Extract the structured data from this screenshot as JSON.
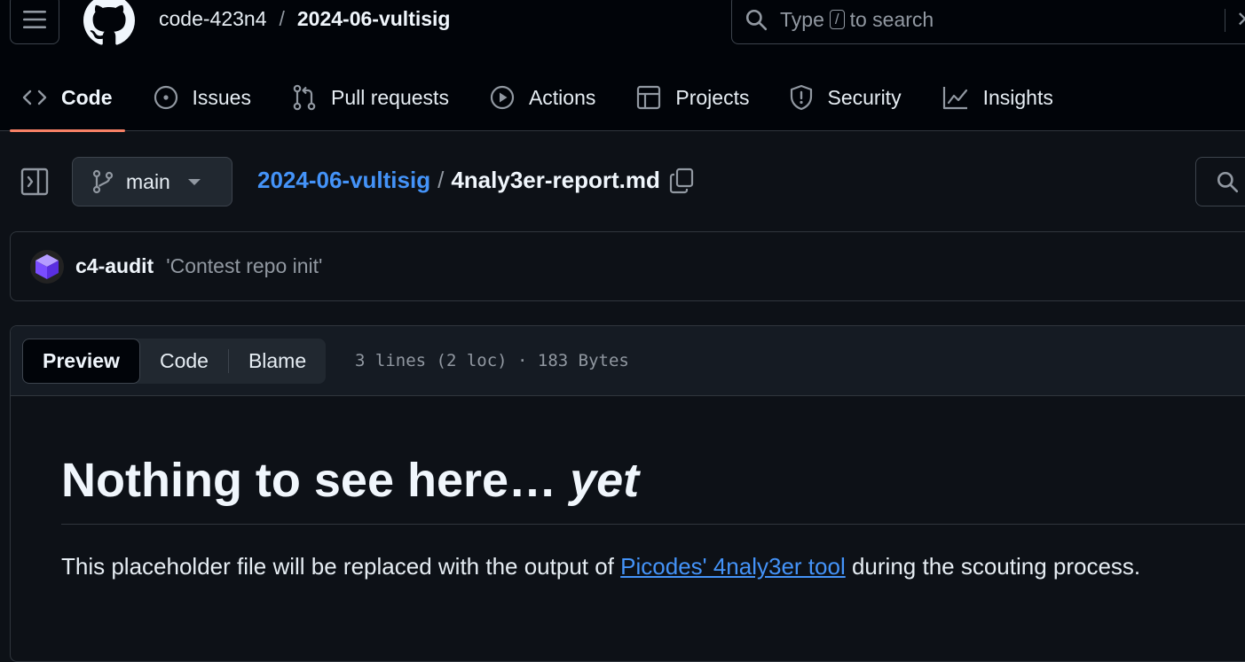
{
  "header": {
    "owner": "code-423n4",
    "separator": "/",
    "repo": "2024-06-vultisig",
    "search": {
      "prefix": "Type",
      "key": "/",
      "suffix": "to search",
      "close_glyph": "✕"
    }
  },
  "tabs": [
    {
      "label": "Code",
      "icon": "code-icon",
      "active": true
    },
    {
      "label": "Issues",
      "icon": "issue-opened-icon"
    },
    {
      "label": "Pull requests",
      "icon": "git-pull-request-icon"
    },
    {
      "label": "Actions",
      "icon": "play-icon"
    },
    {
      "label": "Projects",
      "icon": "table-icon"
    },
    {
      "label": "Security",
      "icon": "shield-icon"
    },
    {
      "label": "Insights",
      "icon": "graph-icon"
    }
  ],
  "filebar": {
    "branch": "main",
    "repo_link": "2024-06-vultisig",
    "slash": "/",
    "file_name": "4naly3er-report.md"
  },
  "commit": {
    "author": "c4-audit",
    "message": "'Contest repo init'"
  },
  "fileview": {
    "modes": [
      "Preview",
      "Code",
      "Blame"
    ],
    "active_mode": "Preview",
    "meta": "3 lines (2 loc) · 183 Bytes"
  },
  "content": {
    "heading": "Nothing to see here…",
    "heading_emphasis": "yet",
    "paragraph_before": "This placeholder file will be replaced with the output of",
    "link_text": "Picodes' 4naly3er tool",
    "paragraph_after": "during the scouting process."
  },
  "colors": {
    "accent": "#f78166",
    "link": "#4493f8",
    "background": "#0d1117",
    "header_background": "#010409"
  }
}
